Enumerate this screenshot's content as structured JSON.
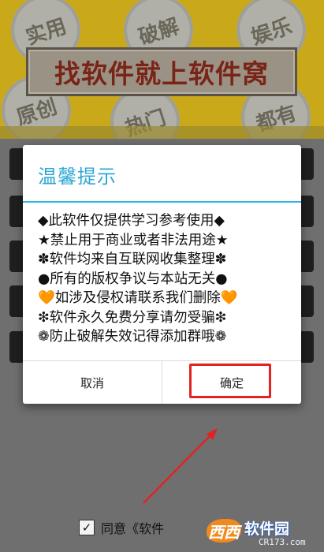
{
  "background": {
    "bubbles": [
      "实用",
      "破解",
      "娱乐",
      "原创",
      "热门",
      "都有"
    ],
    "banner_title": "找软件就上软件窝"
  },
  "dialog": {
    "title": "温馨提示",
    "lines": [
      "◆此软件仅提供学习参考使用◆",
      "★禁止用于商业或者非法用途★",
      "✽软件均来自互联网收集整理✽",
      "●所有的版权争议与本站无关●",
      "🧡如涉及侵权请联系我们删除🧡",
      "❇软件永久免费分享请勿受骗❇",
      "❁防止破解失效记得添加群哦❁"
    ],
    "cancel_label": "取消",
    "ok_label": "确定"
  },
  "footer": {
    "agree_text": "同意《软件",
    "checkbox_checked": true
  },
  "watermark": {
    "logo_text": "西西",
    "name": "软件园",
    "url": "CR173.com"
  },
  "colors": {
    "title_accent": "#33b5e5",
    "highlight": "#e32222"
  }
}
